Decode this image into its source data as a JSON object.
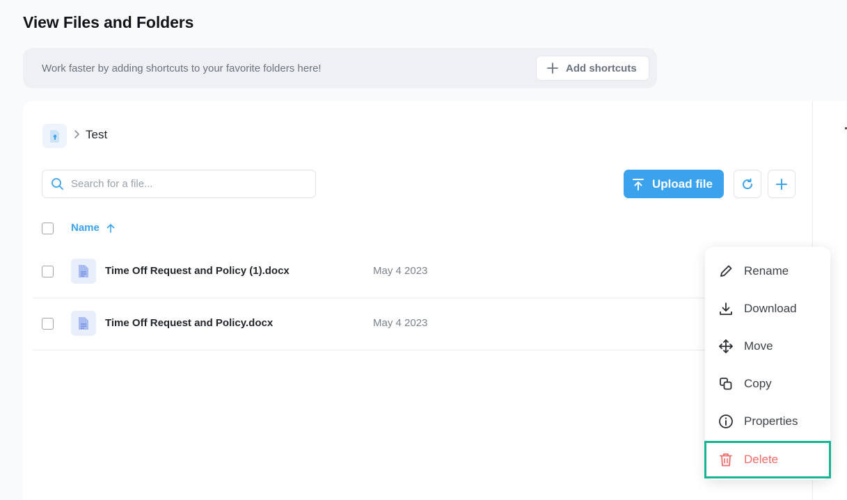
{
  "page": {
    "title": "View Files and Folders"
  },
  "shortcuts": {
    "message": "Work faster by adding shortcuts to your favorite folders here!",
    "add_label": "Add shortcuts"
  },
  "breadcrumb": {
    "current": "Test"
  },
  "search": {
    "placeholder": "Search for a file...",
    "value": ""
  },
  "toolbar": {
    "upload_label": "Upload file"
  },
  "table": {
    "columns": {
      "name": "Name"
    },
    "rows": [
      {
        "name": "Time Off Request and Policy (1).docx",
        "date": "May 4 2023"
      },
      {
        "name": "Time Off Request and Policy.docx",
        "date": "May 4 2023"
      }
    ]
  },
  "context_menu": {
    "items": [
      {
        "label": "Rename",
        "icon": "pencil-icon"
      },
      {
        "label": "Download",
        "icon": "download-icon"
      },
      {
        "label": "Move",
        "icon": "move-icon"
      },
      {
        "label": "Copy",
        "icon": "copy-icon"
      },
      {
        "label": "Properties",
        "icon": "info-icon"
      },
      {
        "label": "Delete",
        "icon": "trash-icon"
      }
    ]
  },
  "colors": {
    "accent": "#3ba3ee",
    "danger": "#ef6b6b",
    "highlight": "#17b494"
  }
}
